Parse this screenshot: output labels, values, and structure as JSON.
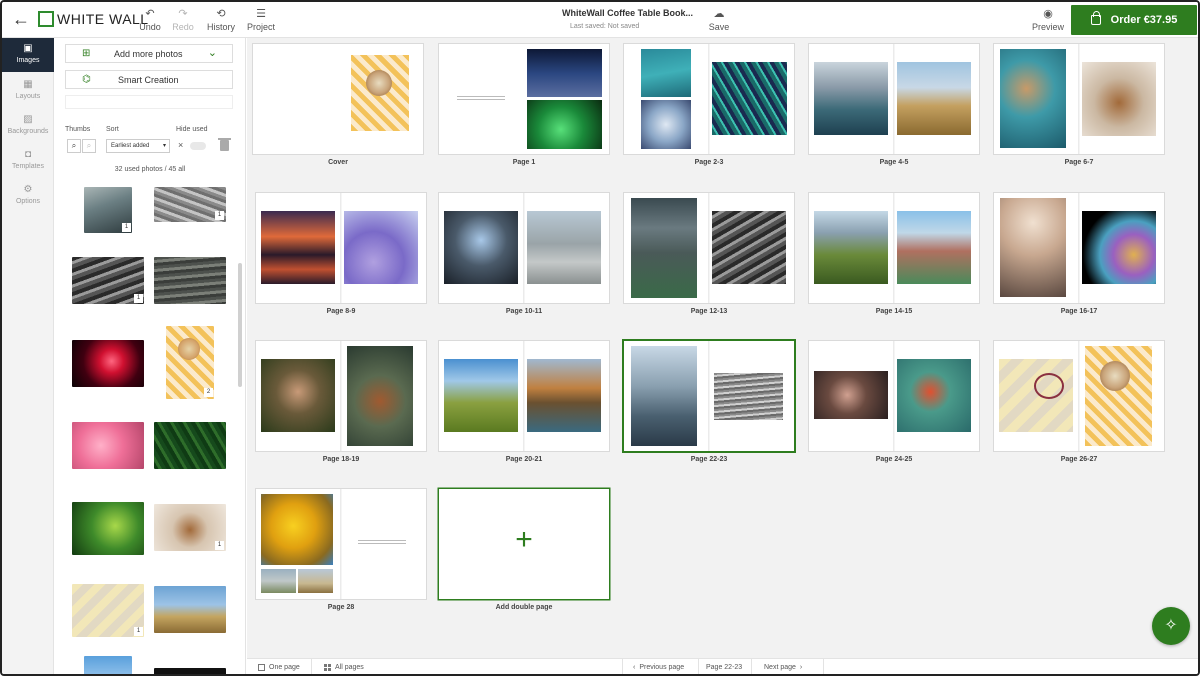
{
  "app": {
    "logo_text": "WHITE WALL",
    "back_label": "←"
  },
  "toolbar": {
    "undo_label": "Undo",
    "redo_label": "Redo",
    "history_label": "History",
    "project_label": "Project",
    "save_label": "Save",
    "preview_label": "Preview"
  },
  "document": {
    "title": "WhiteWall Coffee Table Book...",
    "status": "Last saved: Not saved"
  },
  "order": {
    "label": "Order",
    "price": "€37.95",
    "color": "#2e7d1f"
  },
  "rail": {
    "items": [
      {
        "label": "Images",
        "icon": "images-icon",
        "active": true
      },
      {
        "label": "Layouts",
        "icon": "layouts-icon",
        "active": false
      },
      {
        "label": "Backgrounds",
        "icon": "backgrounds-icon",
        "active": false
      },
      {
        "label": "Templates",
        "icon": "templates-icon",
        "active": false
      },
      {
        "label": "Options",
        "icon": "gear-icon",
        "active": false
      }
    ]
  },
  "panel": {
    "add_photos_label": "Add more photos",
    "smart_creation_label": "Smart Creation",
    "thumbs_label": "Thumbs",
    "sort_label": "Sort",
    "sort_value": "Earliest added",
    "hide_used_label": "Hide used",
    "photo_count": "32 used photos / 45 all",
    "badges": [
      "1",
      "1",
      "1",
      "2",
      "1",
      "1"
    ]
  },
  "spreads": [
    {
      "label": "Cover"
    },
    {
      "label": "Page 1"
    },
    {
      "label": "Page 2-3"
    },
    {
      "label": "Page 4-5"
    },
    {
      "label": "Page 6-7"
    },
    {
      "label": "Page 8-9"
    },
    {
      "label": "Page 10-11"
    },
    {
      "label": "Page 12-13"
    },
    {
      "label": "Page 14-15"
    },
    {
      "label": "Page 16-17"
    },
    {
      "label": "Page 18-19"
    },
    {
      "label": "Page 20-21"
    },
    {
      "label": "Page 22-23",
      "selected": true
    },
    {
      "label": "Page 24-25"
    },
    {
      "label": "Page 26-27"
    },
    {
      "label": "Page 28"
    }
  ],
  "add_double_page": {
    "label": "Add double page",
    "plus": "+"
  },
  "bottombar": {
    "one_page_label": "One page",
    "all_pages_label": "All pages",
    "previous_label": "Previous page",
    "current_label": "Page 22-23",
    "next_label": "Next page"
  }
}
